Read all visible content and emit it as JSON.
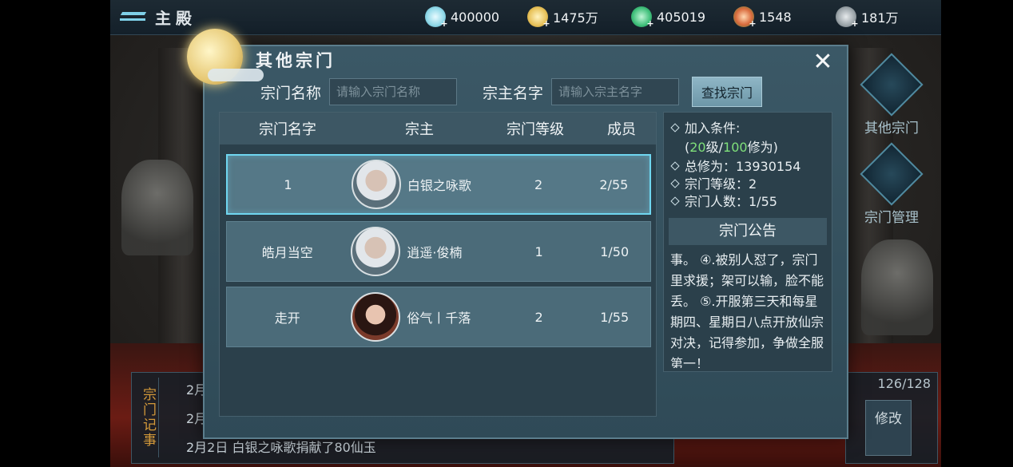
{
  "header": {
    "title": "主殿",
    "currencies": [
      {
        "icon": "spirit-jade-icon",
        "value": "400000",
        "color": "#8fd8e8"
      },
      {
        "icon": "gold-coin-icon",
        "value": "1475万",
        "color": "#e8c25a"
      },
      {
        "icon": "green-jade-icon",
        "value": "405019",
        "color": "#3fbf7a"
      },
      {
        "icon": "gift-gem-icon",
        "value": "1548",
        "color": "#d96a3c"
      },
      {
        "icon": "feather-stone-icon",
        "value": "181万",
        "color": "#9aa3a8"
      }
    ]
  },
  "side": {
    "other_sects": "其他宗门",
    "sect_manage": "宗门管理"
  },
  "log": {
    "tag": "宗门记事",
    "lines": [
      "2月",
      "2月",
      "2月2日  白银之咏歌捐献了80仙玉"
    ]
  },
  "right_panel": {
    "count": "126/128",
    "edit_label": "修改"
  },
  "modal": {
    "title": "其他宗门",
    "close": "✕",
    "search": {
      "name_label": "宗门名称",
      "name_placeholder": "请输入宗门名称",
      "leader_label": "宗主名字",
      "leader_placeholder": "请输入宗主名字",
      "button": "查找宗门"
    },
    "table": {
      "headers": [
        "宗门名字",
        "宗主",
        "宗门等级",
        "成员"
      ],
      "rows": [
        {
          "name": "1",
          "leader": "白银之咏歌",
          "avatar": "male",
          "level": "2",
          "members": "2/55"
        },
        {
          "name": "皓月当空",
          "leader": "逍遥·俊楠",
          "avatar": "male",
          "level": "1",
          "members": "1/50"
        },
        {
          "name": "走开",
          "leader": "俗气丨千落",
          "avatar": "female",
          "level": "2",
          "members": "1/55"
        }
      ]
    },
    "info": {
      "join_label": "加入条件:",
      "join_open": "(",
      "join_level": "20",
      "join_mid": "级/",
      "join_cult": "100",
      "join_close": "修为)",
      "total_cult": "总修为：13930154",
      "sect_level": "宗门等级：2",
      "sect_members": "宗门人数：1/55",
      "notice_title": "宗门公告",
      "notice_text": "事。\n④.被别人怼了，宗门里求援；架可以输，脸不能丢。\n⑤.开服第三天和每星期四、星期日八点开放仙宗对决，记得参加，争做全服第一！"
    }
  }
}
